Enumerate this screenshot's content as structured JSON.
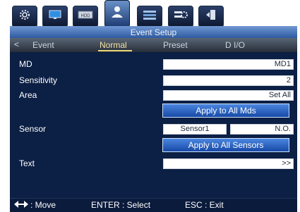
{
  "top_tabs": [
    {
      "icon": "gear-icon",
      "active": false
    },
    {
      "icon": "monitor-icon",
      "active": false
    },
    {
      "icon": "hdd-icon",
      "label": "HDD",
      "active": false
    },
    {
      "icon": "person-icon",
      "active": true
    },
    {
      "icon": "network-icon",
      "active": false
    },
    {
      "icon": "system-settings-icon",
      "active": false
    },
    {
      "icon": "exit-door-icon",
      "active": false
    }
  ],
  "window": {
    "title": "Event Setup"
  },
  "tabs": {
    "left_arrow": "<",
    "items": [
      "Event",
      "Normal",
      "Preset",
      "D I/O"
    ],
    "active": "Normal"
  },
  "rows": {
    "md": {
      "label": "MD",
      "value": "MD1"
    },
    "sensitivity": {
      "label": "Sensitivity",
      "value": "2"
    },
    "area": {
      "label": "Area",
      "value": "Set All"
    },
    "apply_mds": "Apply to All Mds",
    "sensor": {
      "label": "Sensor",
      "value": "Sensor1",
      "type": "N.O."
    },
    "apply_sensors": "Apply to All Sensors",
    "text": {
      "label": "Text",
      "value": ">>"
    }
  },
  "footer": {
    "move": ": Move",
    "select": "ENTER : Select",
    "exit": "ESC : Exit"
  },
  "colors": {
    "panel_bg": "#0c1f44",
    "title_bar": "#4f7cc0",
    "active_tab_text": "#f3e4a6",
    "apply_button": "#2e66c8"
  }
}
